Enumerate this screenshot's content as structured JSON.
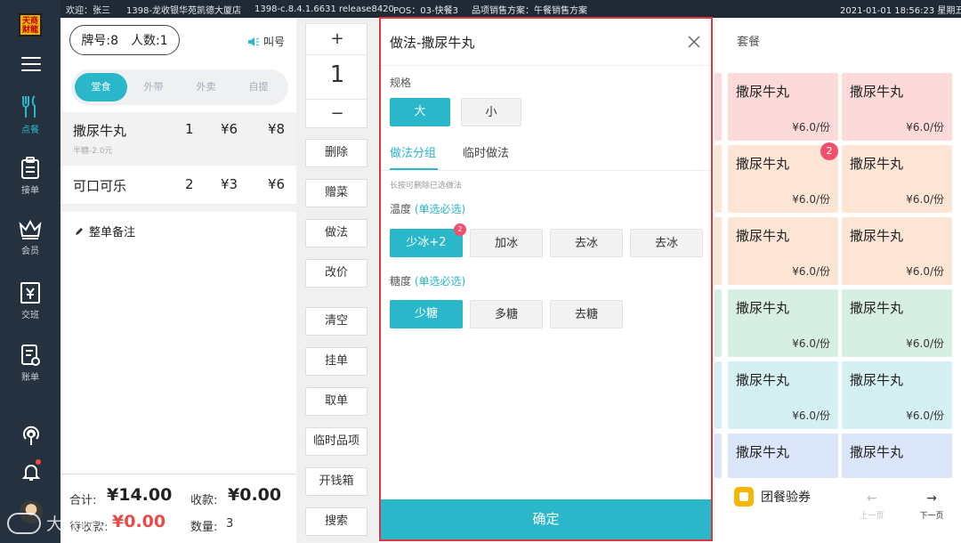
{
  "topbar": {
    "greeting": "欢迎：张三",
    "store": "1398-龙收银华苑凯德大厦店",
    "version": "1398-c.8.4.1.6631 release8420",
    "pos": "POS：03-快餐3",
    "plan": "品项销售方案：午餐销售方案",
    "datetime": "2021-01-01  18:56:23  星期五"
  },
  "nav": {
    "logo_text": "天商财龍",
    "items": [
      {
        "label": "点餐",
        "icon": "utensils-icon"
      },
      {
        "label": "接单",
        "icon": "clipboard-icon"
      },
      {
        "label": "会员",
        "icon": "crown-icon"
      },
      {
        "label": "交班",
        "icon": "cash-register-icon"
      },
      {
        "label": "账单",
        "icon": "bill-icon"
      }
    ]
  },
  "order": {
    "table_no": "牌号:8",
    "guests": "人数:1",
    "call_label": "叫号",
    "modes": [
      "堂食",
      "外带",
      "外卖",
      "自提"
    ],
    "items": [
      {
        "name": "撒尿牛丸",
        "note": "半糖-2.0元",
        "qty": "1",
        "price": "¥6",
        "total": "¥8"
      },
      {
        "name": "可口可乐",
        "note": "",
        "qty": "2",
        "price": "¥3",
        "total": "¥6"
      }
    ],
    "remark_label": "整单备注",
    "total_label": "合计:",
    "total_value": "¥14.00",
    "received_label": "收款:",
    "received_value": "¥0.00",
    "due_label": "待收款:",
    "due_value": "¥0.00",
    "count_label": "数量:",
    "count_value": "3"
  },
  "actions": {
    "qty_plus": "+",
    "qty_value": "1",
    "qty_minus": "−",
    "buttons": [
      "删除",
      "赠菜",
      "做法",
      "改价",
      "清空",
      "挂单",
      "取单",
      "临时品项",
      "开钱箱",
      "搜索"
    ]
  },
  "products": {
    "category_tab": "套餐",
    "cards": [
      {
        "name": "撒尿牛丸",
        "price": "¥6.0/份"
      },
      {
        "name": "撒尿牛丸",
        "price": "¥6.0/份"
      },
      {
        "name": "撒尿牛丸",
        "price": "¥6.0/份"
      },
      {
        "name": "撒尿牛丸",
        "price": "¥6.0/份"
      },
      {
        "name": "撒尿牛丸",
        "price": "¥6.0/份"
      },
      {
        "name": "撒尿牛丸",
        "price": "¥6.0/份"
      },
      {
        "name": "撒尿牛丸",
        "price": "¥6.0/份"
      },
      {
        "name": "撒尿牛丸",
        "price": "¥6.0/份"
      },
      {
        "name": "撒尿牛丸",
        "price": "¥6.0/份"
      },
      {
        "name": "撒尿牛丸",
        "price": "¥6.0/份"
      },
      {
        "name": "撒尿牛丸",
        "price": ""
      },
      {
        "name": "撒尿牛丸",
        "price": ""
      }
    ],
    "card_badge": "2",
    "coupon_label": "团餐验券",
    "prev_page": "上一页",
    "next_page": "下一页"
  },
  "dialog": {
    "title": "做法-撒尿牛丸",
    "spec_label": "规格",
    "specs": [
      "大",
      "小"
    ],
    "tab_group": "做法分组",
    "tab_temp": "临时做法",
    "hint": "长按可删除已选做法",
    "temperature_label": "温度",
    "temperature_req": "(单选必选)",
    "temperature_options": [
      "少冰+2",
      "加冰",
      "去冰",
      "去冰"
    ],
    "temperature_badge": "2",
    "sugar_label": "糖度",
    "sugar_req": "(单选必选)",
    "sugar_options": [
      "少糖",
      "多糖",
      "去糖"
    ],
    "confirm": "确定"
  },
  "watermark": "大数跨境",
  "colors": {
    "accent": "#29b7c9",
    "danger": "#e94a4a",
    "highlight_border": "#e0363e",
    "nav_bg": "#26313f",
    "card_pink": "#fddada",
    "card_peach": "#fde5d6",
    "card_green": "#d6efe2",
    "card_cyan": "#d5f0f3",
    "card_blue": "#dce6fb"
  }
}
